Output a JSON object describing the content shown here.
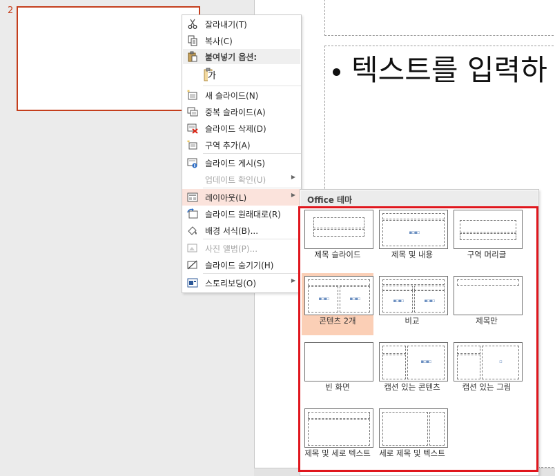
{
  "thumbnail": {
    "slide_number": "2"
  },
  "slide": {
    "bullet_text": "텍스트를 입력하"
  },
  "context_menu": {
    "items": [
      {
        "label": "잘라내기(T)",
        "icon": "scissors-icon",
        "disabled": false
      },
      {
        "label": "복사(C)",
        "icon": "copy-icon",
        "disabled": false
      },
      {
        "label": "새 슬라이드(N)",
        "icon": "new-slide-icon",
        "disabled": false
      },
      {
        "label": "중복 슬라이드(A)",
        "icon": "duplicate-slide-icon",
        "disabled": false
      },
      {
        "label": "슬라이드 삭제(D)",
        "icon": "delete-slide-icon",
        "disabled": false
      },
      {
        "label": "구역 추가(A)",
        "icon": "add-section-icon",
        "disabled": false
      },
      {
        "label": "슬라이드 게시(S)",
        "icon": "publish-slides-icon",
        "disabled": false
      },
      {
        "label": "업데이트 확인(U)",
        "icon": "",
        "disabled": true,
        "submenu": true
      },
      {
        "label": "레이아웃(L)",
        "icon": "layout-icon",
        "disabled": false,
        "submenu": true,
        "highlighted": true
      },
      {
        "label": "슬라이드 원래대로(R)",
        "icon": "reset-slide-icon",
        "disabled": false
      },
      {
        "label": "배경 서식(B)...",
        "icon": "format-background-icon",
        "disabled": false
      },
      {
        "label": "사진 앨범(P)...",
        "icon": "photo-album-icon",
        "disabled": true
      },
      {
        "label": "슬라이드 숨기기(H)",
        "icon": "hide-slide-icon",
        "disabled": false
      },
      {
        "label": "스토리보딩(O)",
        "icon": "storyboarding-icon",
        "disabled": false,
        "submenu": true
      }
    ],
    "paste_header": "붙여넣기 옵션:",
    "paste_option_glyph": "가"
  },
  "layout_menu": {
    "header": "Office 테마",
    "layouts": [
      {
        "label": "제목 슬라이드"
      },
      {
        "label": "제목 및 내용"
      },
      {
        "label": "구역 머리글"
      },
      {
        "label": "콘텐츠 2개",
        "selected": true
      },
      {
        "label": "비교"
      },
      {
        "label": "제목만"
      },
      {
        "label": "빈 화면"
      },
      {
        "label": "캡션 있는 콘텐츠"
      },
      {
        "label": "캡션 있는 그림"
      },
      {
        "label": "제목 및 세로 텍스트"
      },
      {
        "label": "세로 제목 및 텍스트"
      }
    ]
  },
  "colors": {
    "accent": "#c43e1c",
    "highlight": "#fbe3dc",
    "selected_layout": "#fbcfb6",
    "annotation_box": "#e0161d"
  }
}
